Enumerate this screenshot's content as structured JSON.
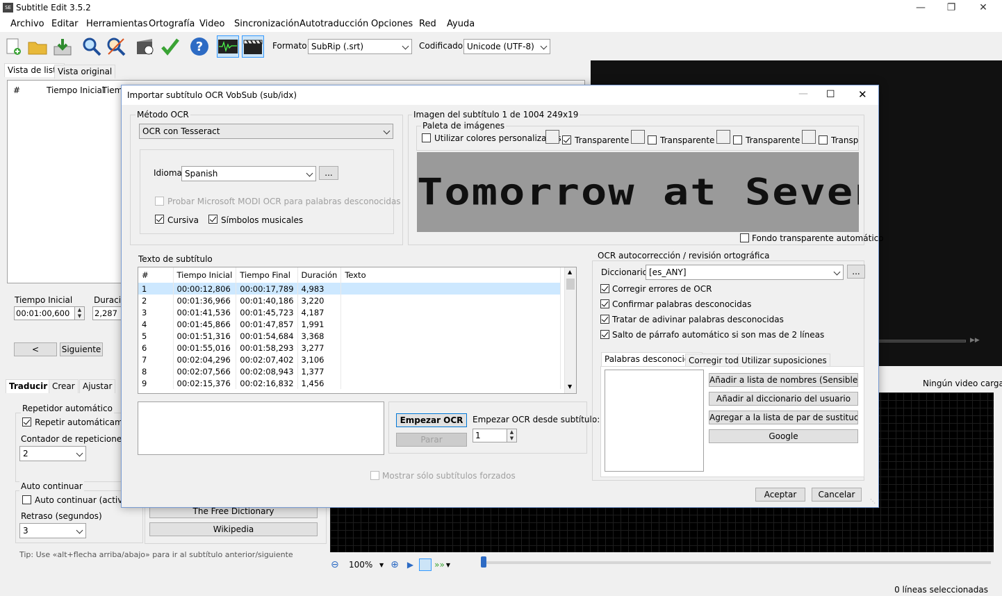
{
  "app": {
    "title": "Subtitle Edit 3.5.2",
    "icon_text": "SE"
  },
  "menu": [
    "Archivo",
    "Editar",
    "Herramientas",
    "Ortografía",
    "Video",
    "Sincronización",
    "Autotraducción",
    "Opciones",
    "Red",
    "Ayuda"
  ],
  "toolbar": {
    "format_label": "Formato",
    "format_value": "SubRip (.srt)",
    "encoding_label": "Codificador",
    "encoding_value": "Unicode (UTF-8)"
  },
  "left_tabs": [
    "Vista de lista",
    "Vista original"
  ],
  "list_headers": [
    "#",
    "Tiempo Inicial",
    "Tiemp"
  ],
  "edit": {
    "start_label": "Tiempo Inicial",
    "start_value": "00:01:00,600",
    "duration_label": "Duració",
    "duration_value": "2,287",
    "prev_button": "<",
    "next_button": "Siguiente"
  },
  "bottom_tabs": [
    "Traducir",
    "Crear",
    "Ajustar"
  ],
  "auto_repeat": {
    "group": "Repetidor automático",
    "check_label": "Repetir automáticamente",
    "count_label": "Contador de repeticiones (vec",
    "count_value": "2"
  },
  "auto_continue": {
    "group": "Auto continuar",
    "check_label": "Auto continuar (activar)",
    "delay_label": "Retraso (segundos)",
    "delay_value": "3"
  },
  "lookup_buttons": [
    "The Free Dictionary",
    "Wikipedia"
  ],
  "tip": "Tip: Use «alt+flecha arriba/abajo» para ir al subtítulo anterior/siguiente",
  "video": {
    "no_video": "Ningún video cargado"
  },
  "zoom": {
    "value": "100%"
  },
  "status": {
    "text": "0 líneas seleccionadas"
  },
  "dialog": {
    "title": "Importar subtítulo OCR VobSub (sub/idx)",
    "ocr_method_group": "Método OCR",
    "ocr_method_value": "OCR con Tesseract",
    "language_label": "Idioma",
    "language_value": "Spanish",
    "language_more": "...",
    "modi_label": "Probar Microsoft MODI OCR para palabras desconocidas",
    "italic_label": "Cursiva",
    "music_label": "Símbolos musicales",
    "image_group": "Imagen del subtítulo 1 de 1004   249x19",
    "palette_group": "Paleta de imágenes",
    "custom_colors_label": "Utilizar colores personalizados",
    "transparent_labels": [
      "Transparente",
      "Transparente",
      "Transparente",
      "Transpar"
    ],
    "ocr_image_text": "Tomorrow at Seven",
    "auto_bg_label": "Fondo transparente automático",
    "subtitle_text_group": "Texto de subtítulo",
    "table_headers": [
      "#",
      "Tiempo Inicial",
      "Tiempo Final",
      "Duración",
      "Texto"
    ],
    "rows": [
      {
        "n": "1",
        "start": "00:00:12,806",
        "end": "00:00:17,789",
        "dur": "4,983",
        "text": ""
      },
      {
        "n": "2",
        "start": "00:01:36,966",
        "end": "00:01:40,186",
        "dur": "3,220",
        "text": ""
      },
      {
        "n": "3",
        "start": "00:01:41,536",
        "end": "00:01:45,723",
        "dur": "4,187",
        "text": ""
      },
      {
        "n": "4",
        "start": "00:01:45,866",
        "end": "00:01:47,857",
        "dur": "1,991",
        "text": ""
      },
      {
        "n": "5",
        "start": "00:01:51,316",
        "end": "00:01:54,684",
        "dur": "3,368",
        "text": ""
      },
      {
        "n": "6",
        "start": "00:01:55,016",
        "end": "00:01:58,293",
        "dur": "3,277",
        "text": ""
      },
      {
        "n": "7",
        "start": "00:02:04,296",
        "end": "00:02:07,402",
        "dur": "3,106",
        "text": ""
      },
      {
        "n": "8",
        "start": "00:02:07,566",
        "end": "00:02:08,943",
        "dur": "1,377",
        "text": ""
      },
      {
        "n": "9",
        "start": "00:02:15,376",
        "end": "00:02:16,832",
        "dur": "1,456",
        "text": ""
      }
    ],
    "start_ocr_button": "Empezar OCR",
    "stop_button": "Parar",
    "start_from_label": "Empezar OCR desde subtítulo:",
    "start_from_value": "1",
    "forced_only_label": "Mostrar sólo subtítulos forzados",
    "autocorrect_group": "OCR autocorrección / revisión ortográfica",
    "dictionary_label": "Diccionario:",
    "dictionary_value": "[es_ANY]",
    "dictionary_more": "...",
    "checks": [
      "Corregir errores de OCR",
      "Confirmar palabras desconocidas",
      "Tratar de adivinar palabras desconocidas",
      "Salto de párrafo automático si son mas de 2 líneas"
    ],
    "word_tabs": [
      "Palabras desconocidas",
      "Corregir todo",
      "Utilizar suposiciones"
    ],
    "word_buttons": [
      "Añadir a lista de nombres (Sensible",
      "Añadir al diccionario del usuario",
      "Agregar a la lista de par de sustitución",
      "Google"
    ],
    "ok_button": "Aceptar",
    "cancel_button": "Cancelar"
  }
}
